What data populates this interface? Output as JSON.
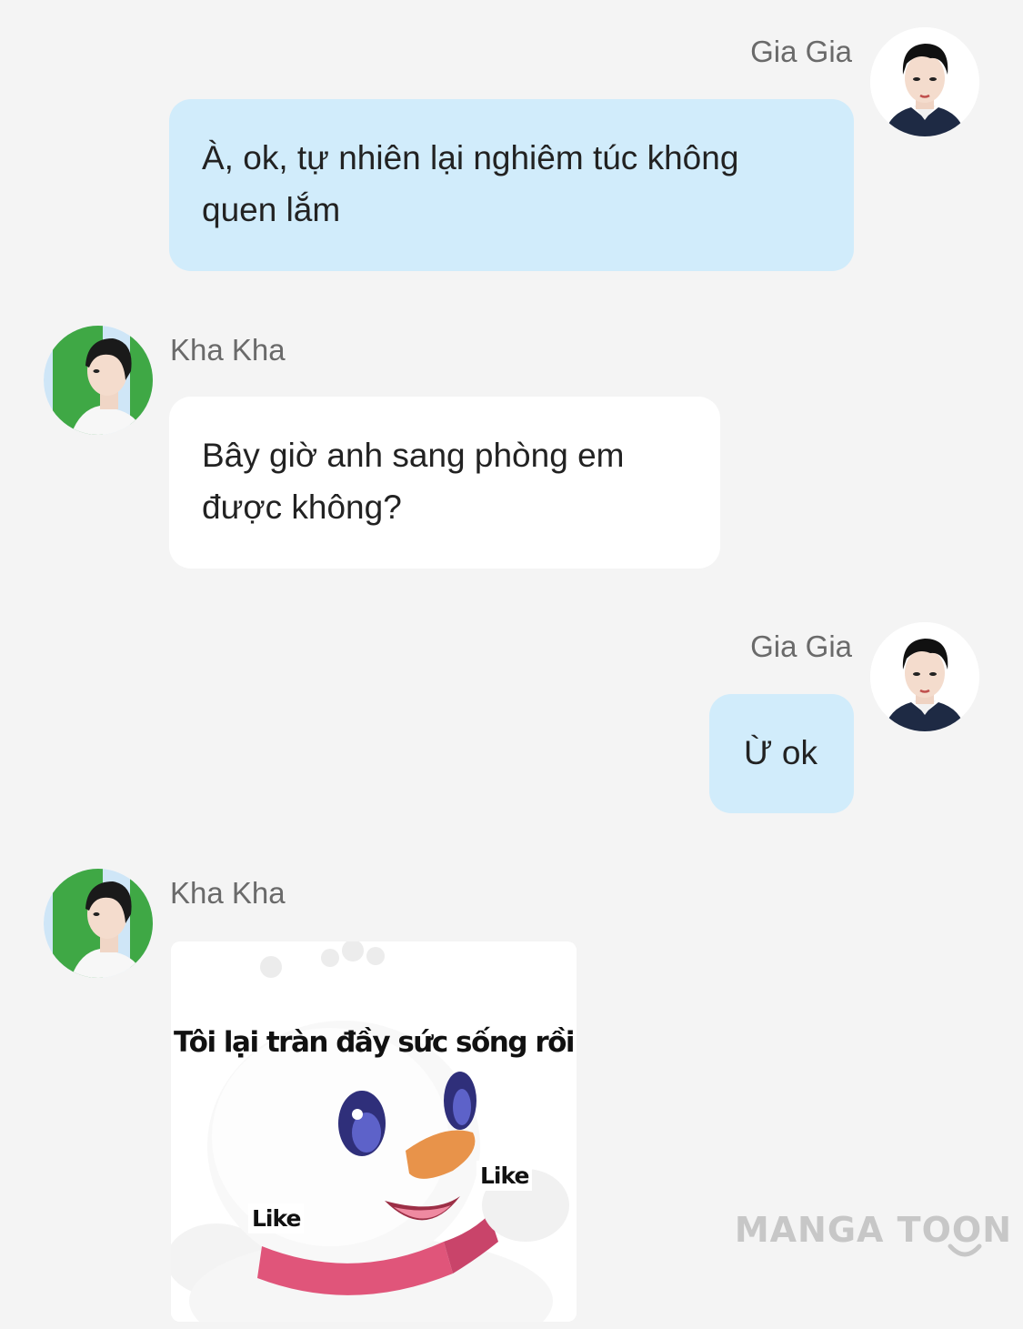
{
  "messages": [
    {
      "sender": "Gia Gia",
      "side": "right",
      "text": "À, ok, tự nhiên lại nghiêm túc không quen lắm"
    },
    {
      "sender": "Kha Kha",
      "side": "left",
      "text": "Bây giờ anh sang phòng em được không?"
    },
    {
      "sender": "Gia Gia",
      "side": "right",
      "text": "Ừ ok"
    },
    {
      "sender": "Kha Kha",
      "side": "left",
      "type": "sticker",
      "sticker": {
        "caption": "Tôi lại tràn đầy sức sống rồi",
        "tag_left": "Like",
        "tag_right": "Like",
        "icon": "snowman-sticker"
      }
    }
  ],
  "watermark": "MANGA TOON",
  "colors": {
    "background": "#f4f4f4",
    "my_bubble": "#d1ecfb",
    "their_bubble": "#ffffff",
    "name_text": "#6a6a6a"
  }
}
